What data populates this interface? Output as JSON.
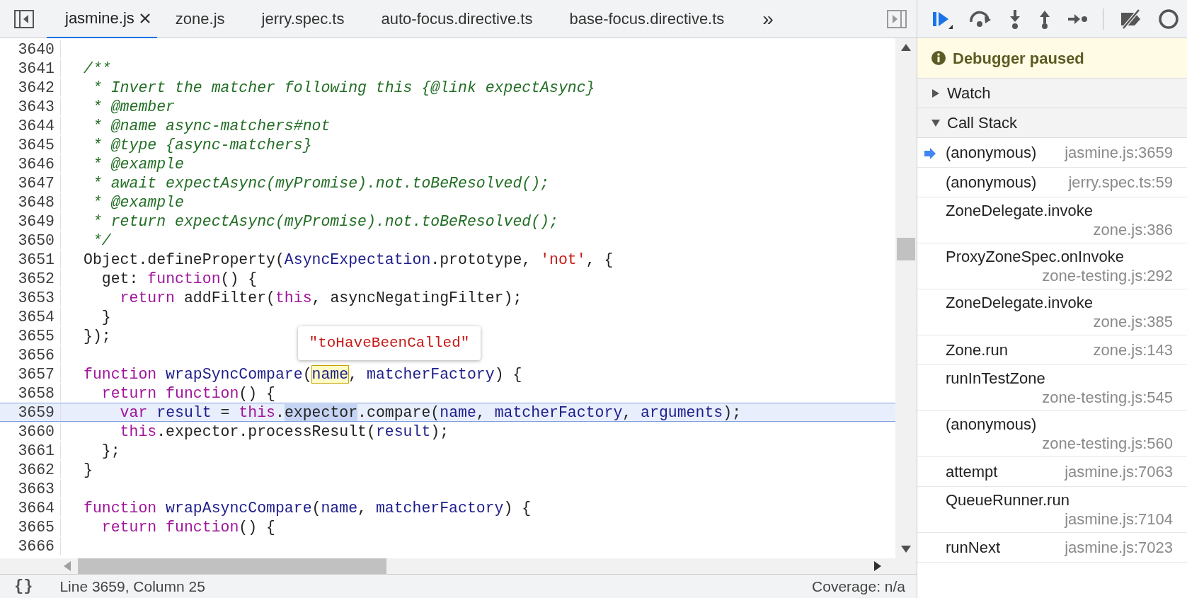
{
  "editor": {
    "tabs": [
      {
        "label": "jasmine.js",
        "selected": true
      },
      {
        "label": "zone.js",
        "selected": false
      },
      {
        "label": "jerry.spec.ts",
        "selected": false
      },
      {
        "label": "auto-focus.directive.ts",
        "selected": false
      },
      {
        "label": "base-focus.directive.ts",
        "selected": false
      }
    ],
    "tab_overflow": "»",
    "lines": [
      {
        "number": "3640",
        "current": false
      },
      {
        "number": "3641",
        "current": false,
        "tokens": [
          {
            "text": "/**",
            "kind": "comment"
          }
        ]
      },
      {
        "number": "3642",
        "current": false,
        "tokens": [
          {
            "text": " * Invert the matcher following this {@link expectAsync}",
            "kind": "comment"
          }
        ]
      },
      {
        "number": "3643",
        "current": false,
        "tokens": [
          {
            "text": " * @member",
            "kind": "comment"
          }
        ]
      },
      {
        "number": "3644",
        "current": false,
        "tokens": [
          {
            "text": " * @name async-matchers#not",
            "kind": "comment"
          }
        ]
      },
      {
        "number": "3645",
        "current": false,
        "tokens": [
          {
            "text": " * @type {async-matchers}",
            "kind": "comment"
          }
        ]
      },
      {
        "number": "3646",
        "current": false,
        "tokens": [
          {
            "text": " * @example",
            "kind": "comment"
          }
        ]
      },
      {
        "number": "3647",
        "current": false,
        "tokens": [
          {
            "text": " * await expectAsync(myPromise).not.toBeResolved();",
            "kind": "comment"
          }
        ]
      },
      {
        "number": "3648",
        "current": false,
        "tokens": [
          {
            "text": " * @example",
            "kind": "comment"
          }
        ]
      },
      {
        "number": "3649",
        "current": false,
        "tokens": [
          {
            "text": " * return expectAsync(myPromise).not.toBeResolved();",
            "kind": "comment"
          }
        ]
      },
      {
        "number": "3650",
        "current": false,
        "tokens": [
          {
            "text": " */",
            "kind": "comment"
          }
        ]
      },
      {
        "number": "3651",
        "current": false,
        "tokens": [
          {
            "text": "Object.defineProperty(",
            "kind": "plain"
          },
          {
            "text": "AsyncExpectation",
            "kind": "variable"
          },
          {
            "text": ".prototype, ",
            "kind": "plain"
          },
          {
            "text": "'not'",
            "kind": "string"
          },
          {
            "text": ", {",
            "kind": "plain"
          }
        ]
      },
      {
        "number": "3652",
        "current": false,
        "tokens": [
          {
            "text": "  get: ",
            "kind": "plain"
          },
          {
            "text": "function",
            "kind": "keyword"
          },
          {
            "text": "() {",
            "kind": "plain"
          }
        ]
      },
      {
        "number": "3653",
        "current": false,
        "tokens": [
          {
            "text": "    return",
            "kind": "keyword"
          },
          {
            "text": " addFilter(",
            "kind": "plain"
          },
          {
            "text": "this",
            "kind": "keyword"
          },
          {
            "text": ", asyncNegatingFilter);",
            "kind": "plain"
          }
        ]
      },
      {
        "number": "3654",
        "current": false,
        "tokens": [
          {
            "text": "  }",
            "kind": "plain"
          }
        ]
      },
      {
        "number": "3655",
        "current": false,
        "tokens": [
          {
            "text": "});",
            "kind": "plain"
          }
        ]
      },
      {
        "number": "3656",
        "current": false
      },
      {
        "number": "3657",
        "current": false,
        "tokens": [
          {
            "text": "function",
            "kind": "keyword"
          },
          {
            "text": " wrapSyncCompare",
            "kind": "variable"
          },
          {
            "text": "(",
            "kind": "plain"
          },
          {
            "text": "name",
            "kind": "hovered"
          },
          {
            "text": ", ",
            "kind": "plain"
          },
          {
            "text": "matcherFactory",
            "kind": "variable"
          },
          {
            "text": ") {",
            "kind": "plain"
          }
        ]
      },
      {
        "number": "3658",
        "current": false,
        "tokens": [
          {
            "text": "  return",
            "kind": "keyword"
          },
          {
            "text": " function",
            "kind": "keyword"
          },
          {
            "text": "() {",
            "kind": "plain"
          }
        ]
      },
      {
        "number": "3659",
        "current": true,
        "tokens": [
          {
            "text": "    var",
            "kind": "keyword"
          },
          {
            "text": " result",
            "kind": "variable"
          },
          {
            "text": " = ",
            "kind": "plain"
          },
          {
            "text": "this",
            "kind": "keyword"
          },
          {
            "text": ".",
            "kind": "plain"
          },
          {
            "text": "expector",
            "kind": "selected"
          },
          {
            "text": ".compare(",
            "kind": "plain"
          },
          {
            "text": "name",
            "kind": "variable"
          },
          {
            "text": ", ",
            "kind": "plain"
          },
          {
            "text": "matcherFactory",
            "kind": "variable"
          },
          {
            "text": ", ",
            "kind": "plain"
          },
          {
            "text": "arguments",
            "kind": "variable"
          },
          {
            "text": ");",
            "kind": "plain"
          }
        ]
      },
      {
        "number": "3660",
        "current": false,
        "tokens": [
          {
            "text": "    this",
            "kind": "keyword"
          },
          {
            "text": ".expector.processResult(",
            "kind": "plain"
          },
          {
            "text": "result",
            "kind": "variable"
          },
          {
            "text": ");",
            "kind": "plain"
          }
        ]
      },
      {
        "number": "3661",
        "current": false,
        "tokens": [
          {
            "text": "  };",
            "kind": "plain"
          }
        ]
      },
      {
        "number": "3662",
        "current": false,
        "tokens": [
          {
            "text": "}",
            "kind": "plain"
          }
        ]
      },
      {
        "number": "3663",
        "current": false
      },
      {
        "number": "3664",
        "current": false,
        "tokens": [
          {
            "text": "function",
            "kind": "keyword"
          },
          {
            "text": " wrapAsyncCompare",
            "kind": "variable"
          },
          {
            "text": "(",
            "kind": "plain"
          },
          {
            "text": "name",
            "kind": "variable"
          },
          {
            "text": ", ",
            "kind": "plain"
          },
          {
            "text": "matcherFactory",
            "kind": "variable"
          },
          {
            "text": ") {",
            "kind": "plain"
          }
        ]
      },
      {
        "number": "3665",
        "current": false,
        "tokens": [
          {
            "text": "  return",
            "kind": "keyword"
          },
          {
            "text": " function",
            "kind": "keyword"
          },
          {
            "text": "() {",
            "kind": "plain"
          }
        ]
      },
      {
        "number": "3666",
        "current": false
      }
    ],
    "tooltip": {
      "text": "\"toHaveBeenCalled\""
    },
    "status_bar": {
      "format_button": "{}",
      "position": "Line 3659, Column 25",
      "coverage": "Coverage: n/a"
    }
  },
  "debugger": {
    "paused_message": "Debugger paused",
    "sections": [
      {
        "title": "Watch",
        "expanded": false
      },
      {
        "title": "Call Stack",
        "expanded": true
      }
    ],
    "call_stack": [
      {
        "function": "(anonymous)",
        "location": "jasmine.js:3659",
        "current": true
      },
      {
        "function": "(anonymous)",
        "location": "jerry.spec.ts:59",
        "current": false
      },
      {
        "function": "ZoneDelegate.invoke",
        "location": "zone.js:386",
        "current": false
      },
      {
        "function": "ProxyZoneSpec.onInvoke",
        "location": "zone-testing.js:292",
        "current": false
      },
      {
        "function": "ZoneDelegate.invoke",
        "location": "zone.js:385",
        "current": false
      },
      {
        "function": "Zone.run",
        "location": "zone.js:143",
        "current": false
      },
      {
        "function": "runInTestZone",
        "location": "zone-testing.js:545",
        "current": false
      },
      {
        "function": "(anonymous)",
        "location": "zone-testing.js:560",
        "current": false
      },
      {
        "function": "attempt",
        "location": "jasmine.js:7063",
        "current": false
      },
      {
        "function": "QueueRunner.run",
        "location": "jasmine.js:7104",
        "current": false
      },
      {
        "function": "runNext",
        "location": "jasmine.js:7023",
        "current": false
      }
    ]
  }
}
